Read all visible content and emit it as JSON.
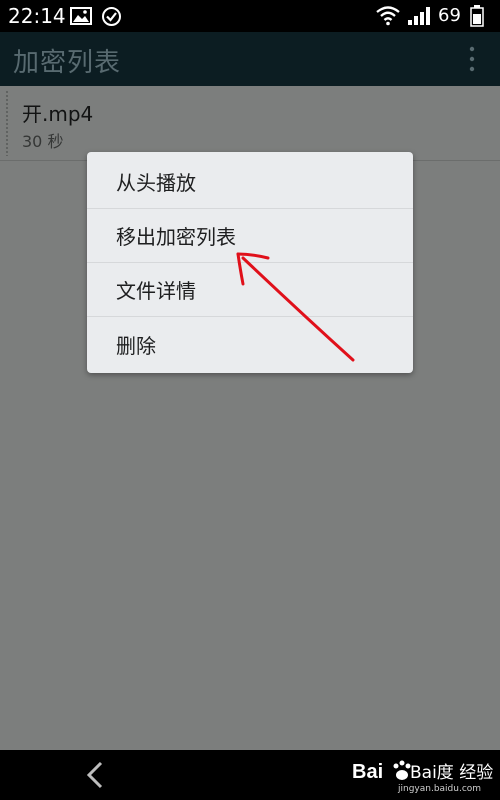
{
  "status_bar": {
    "time": "22:14",
    "battery": "69",
    "icons": [
      "image-icon",
      "check-circle-icon",
      "wifi-icon",
      "signal-icon",
      "battery-icon"
    ]
  },
  "app_bar": {
    "title": "加密列表",
    "icons": [
      "overflow-menu-icon"
    ]
  },
  "list": {
    "items": [
      {
        "name": "开.mp4",
        "duration": "30 秒"
      }
    ]
  },
  "context_menu": {
    "items": [
      {
        "label": "从头播放"
      },
      {
        "label": "移出加密列表"
      },
      {
        "label": "文件详情"
      },
      {
        "label": "删除"
      }
    ]
  },
  "nav_bar": {
    "icons": [
      "back-icon"
    ]
  },
  "watermark": {
    "text": "Bai度 经验",
    "url": "jingyan.baidu.com"
  },
  "colors": {
    "status_bar": "#000000",
    "app_bar": "#0c1d22",
    "app_title": "#586a70",
    "overlay": "#7b7d7b",
    "menu_bg": "#eaecee",
    "annotation": "#e0101a"
  }
}
